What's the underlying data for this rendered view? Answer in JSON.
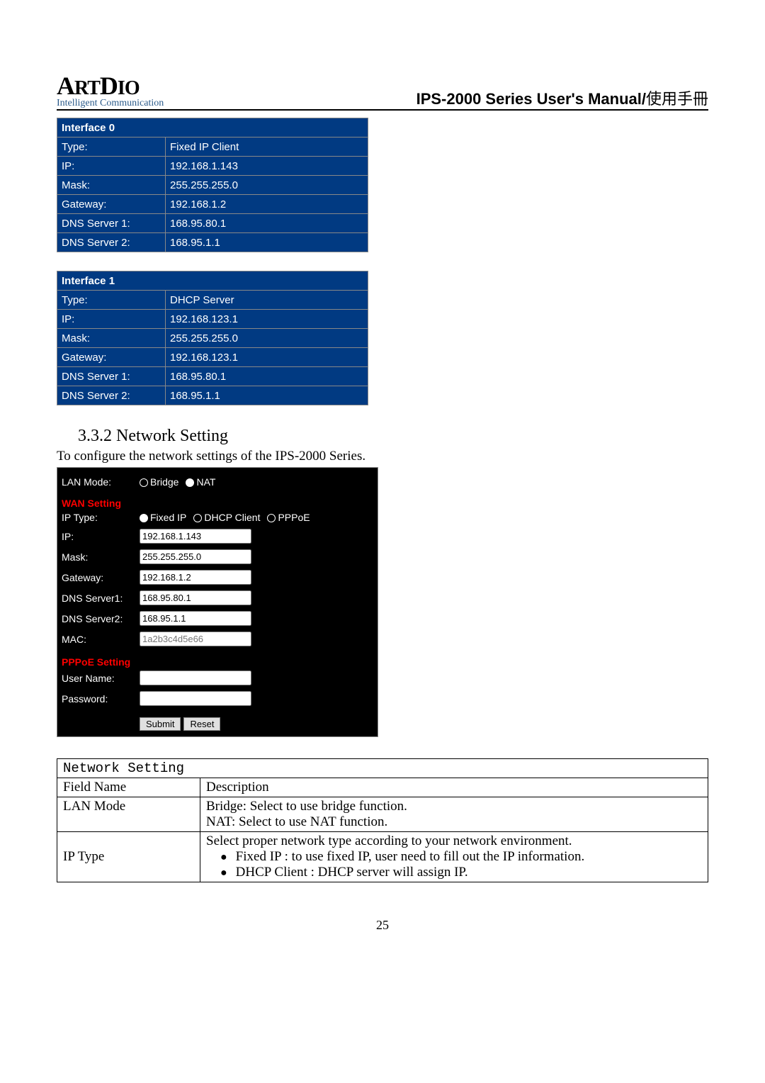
{
  "header": {
    "logo_main": "ArtDio",
    "tagline": "Intelligent Communication",
    "manual_title": "IPS-2000 Series User's Manual/",
    "manual_title_cjk": "使用手冊"
  },
  "interface0": {
    "title": "Interface 0",
    "rows": [
      {
        "label": "Type:",
        "value": "Fixed IP Client"
      },
      {
        "label": "IP:",
        "value": "192.168.1.143"
      },
      {
        "label": "Mask:",
        "value": "255.255.255.0"
      },
      {
        "label": "Gateway:",
        "value": "192.168.1.2"
      },
      {
        "label": "DNS Server 1:",
        "value": "168.95.80.1"
      },
      {
        "label": "DNS Server 2:",
        "value": "168.95.1.1"
      }
    ]
  },
  "interface1": {
    "title": "Interface 1",
    "rows": [
      {
        "label": "Type:",
        "value": "DHCP Server"
      },
      {
        "label": "IP:",
        "value": "192.168.123.1"
      },
      {
        "label": "Mask:",
        "value": "255.255.255.0"
      },
      {
        "label": "Gateway:",
        "value": "192.168.123.1"
      },
      {
        "label": "DNS Server 1:",
        "value": "168.95.80.1"
      },
      {
        "label": "DNS Server 2:",
        "value": "168.95.1.1"
      }
    ]
  },
  "section": {
    "number_title": "3.3.2 Network Setting",
    "desc": "To configure the network settings of the IPS-2000 Series."
  },
  "form": {
    "lan_mode_label": "LAN Mode:",
    "lan_options": [
      "Bridge",
      "NAT"
    ],
    "lan_selected_index": 1,
    "wan_heading": "WAN Setting",
    "ip_type_label": "IP Type:",
    "ip_type_options": [
      "Fixed IP",
      "DHCP Client",
      "PPPoE"
    ],
    "ip_type_selected_index": 0,
    "fields": {
      "ip_label": "IP:",
      "ip_value": "192.168.1.143",
      "mask_label": "Mask:",
      "mask_value": "255.255.255.0",
      "gateway_label": "Gateway:",
      "gateway_value": "192.168.1.2",
      "dns1_label": "DNS Server1:",
      "dns1_value": "168.95.80.1",
      "dns2_label": "DNS Server2:",
      "dns2_value": "168.95.1.1",
      "mac_label": "MAC:",
      "mac_placeholder": "1a2b3c4d5e66"
    },
    "pppoe_heading": "PPPoE Setting",
    "username_label": "User Name:",
    "username_value": "",
    "password_label": "Password:",
    "password_value": "",
    "submit_label": "Submit",
    "reset_label": "Reset"
  },
  "desc_table": {
    "title": "Network Setting",
    "col_field": "Field Name",
    "col_desc": "Description",
    "rows": [
      {
        "field": "LAN Mode",
        "desc_lines": [
          "Bridge: Select to use bridge function.",
          "NAT: Select to use NAT function."
        ]
      },
      {
        "field": "IP Type",
        "desc_intro": "Select proper network type according to your network environment.",
        "bullets": [
          "Fixed IP : to use fixed IP, user need to fill out the IP information.",
          "DHCP Client : DHCP server will assign IP."
        ]
      }
    ]
  },
  "page_number": "25"
}
